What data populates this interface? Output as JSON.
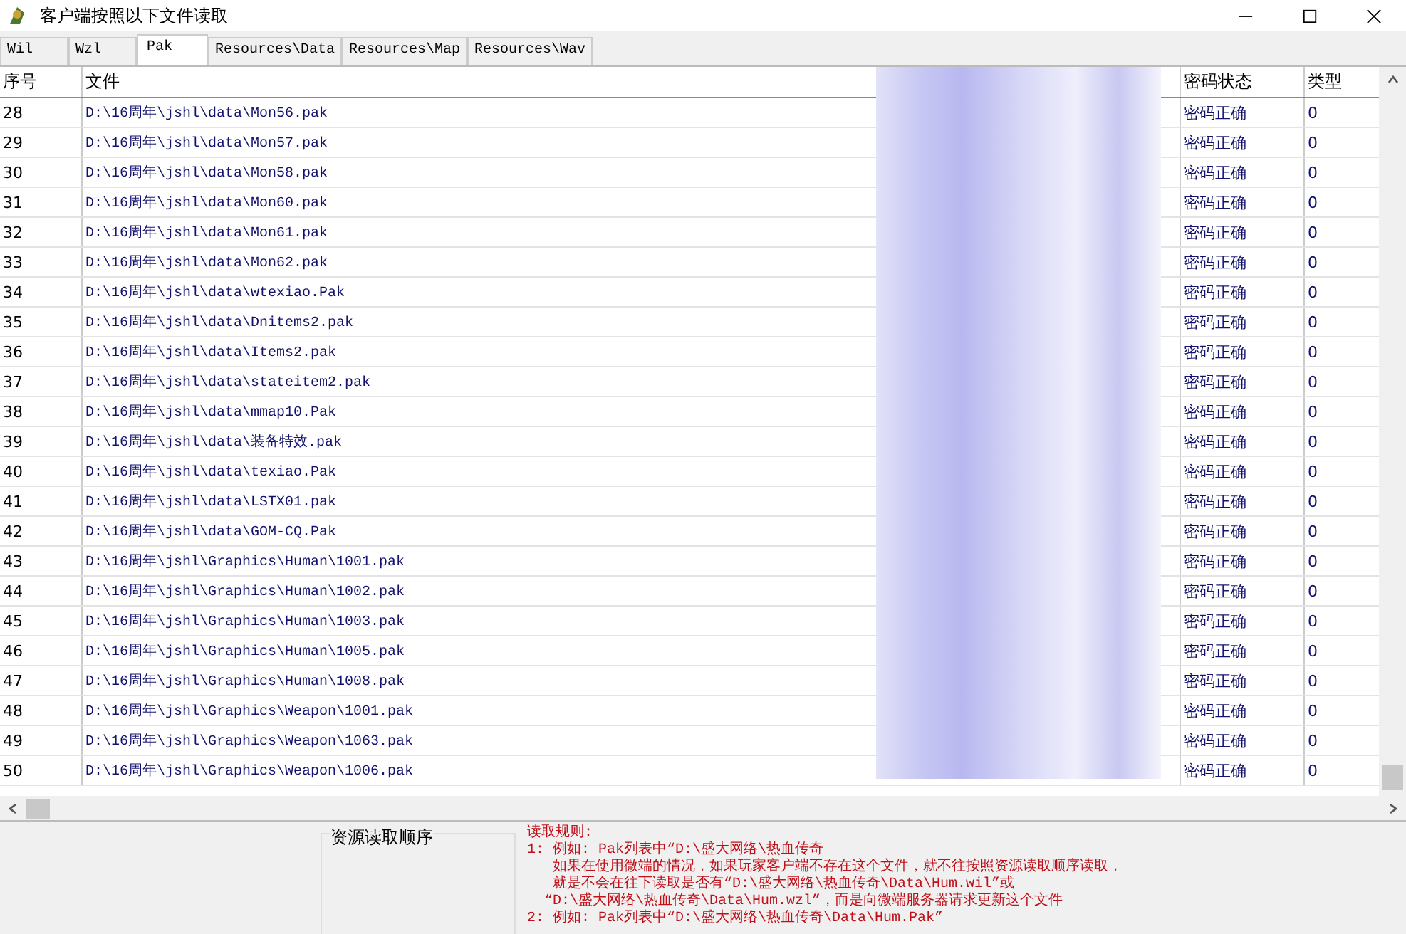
{
  "window": {
    "title": "客户端按照以下文件读取"
  },
  "tabs": [
    {
      "label": "Wil",
      "selected": false
    },
    {
      "label": "Wzl",
      "selected": false
    },
    {
      "label": "Pak",
      "selected": true
    },
    {
      "label": "Resources\\Data",
      "selected": false
    },
    {
      "label": "Resources\\Map",
      "selected": false
    },
    {
      "label": "Resources\\Wav",
      "selected": false
    }
  ],
  "table": {
    "columns": [
      "序号",
      "文件",
      "密码状态",
      "类型"
    ],
    "rows": [
      {
        "index": "28",
        "file": "D:\\16周年\\jshl\\data\\Mon56.pak",
        "status": "密码正确",
        "type": "0"
      },
      {
        "index": "29",
        "file": "D:\\16周年\\jshl\\data\\Mon57.pak",
        "status": "密码正确",
        "type": "0"
      },
      {
        "index": "30",
        "file": "D:\\16周年\\jshl\\data\\Mon58.pak",
        "status": "密码正确",
        "type": "0"
      },
      {
        "index": "31",
        "file": "D:\\16周年\\jshl\\data\\Mon60.pak",
        "status": "密码正确",
        "type": "0"
      },
      {
        "index": "32",
        "file": "D:\\16周年\\jshl\\data\\Mon61.pak",
        "status": "密码正确",
        "type": "0"
      },
      {
        "index": "33",
        "file": "D:\\16周年\\jshl\\data\\Mon62.pak",
        "status": "密码正确",
        "type": "0"
      },
      {
        "index": "34",
        "file": "D:\\16周年\\jshl\\data\\wtexiao.Pak",
        "status": "密码正确",
        "type": "0"
      },
      {
        "index": "35",
        "file": "D:\\16周年\\jshl\\data\\Dnitems2.pak",
        "status": "密码正确",
        "type": "0"
      },
      {
        "index": "36",
        "file": "D:\\16周年\\jshl\\data\\Items2.pak",
        "status": "密码正确",
        "type": "0"
      },
      {
        "index": "37",
        "file": "D:\\16周年\\jshl\\data\\stateitem2.pak",
        "status": "密码正确",
        "type": "0"
      },
      {
        "index": "38",
        "file": "D:\\16周年\\jshl\\data\\mmap10.Pak",
        "status": "密码正确",
        "type": "0"
      },
      {
        "index": "39",
        "file": "D:\\16周年\\jshl\\data\\装备特效.pak",
        "status": "密码正确",
        "type": "0"
      },
      {
        "index": "40",
        "file": "D:\\16周年\\jshl\\data\\texiao.Pak",
        "status": "密码正确",
        "type": "0"
      },
      {
        "index": "41",
        "file": "D:\\16周年\\jshl\\data\\LSTX01.pak",
        "status": "密码正确",
        "type": "0"
      },
      {
        "index": "42",
        "file": "D:\\16周年\\jshl\\data\\GOM-CQ.Pak",
        "status": "密码正确",
        "type": "0"
      },
      {
        "index": "43",
        "file": "D:\\16周年\\jshl\\Graphics\\Human\\1001.pak",
        "status": "密码正确",
        "type": "0"
      },
      {
        "index": "44",
        "file": "D:\\16周年\\jshl\\Graphics\\Human\\1002.pak",
        "status": "密码正确",
        "type": "0"
      },
      {
        "index": "45",
        "file": "D:\\16周年\\jshl\\Graphics\\Human\\1003.pak",
        "status": "密码正确",
        "type": "0"
      },
      {
        "index": "46",
        "file": "D:\\16周年\\jshl\\Graphics\\Human\\1005.pak",
        "status": "密码正确",
        "type": "0"
      },
      {
        "index": "47",
        "file": "D:\\16周年\\jshl\\Graphics\\Human\\1008.pak",
        "status": "密码正确",
        "type": "0"
      },
      {
        "index": "48",
        "file": "D:\\16周年\\jshl\\Graphics\\Weapon\\1001.pak",
        "status": "密码正确",
        "type": "0"
      },
      {
        "index": "49",
        "file": "D:\\16周年\\jshl\\Graphics\\Weapon\\1063.pak",
        "status": "密码正确",
        "type": "0"
      },
      {
        "index": "50",
        "file": "D:\\16周年\\jshl\\Graphics\\Weapon\\1006.pak",
        "status": "密码正确",
        "type": "0"
      }
    ]
  },
  "order_group": {
    "title": "资源读取顺序"
  },
  "rules": [
    "读取规则:",
    "1: 例如: Pak列表中“D:\\盛大网络\\热血传奇",
    "   如果在使用微端的情况，如果玩家客户端不存在这个文件，就不往按照资源读取顺序读取，",
    "   就是不会在往下读取是否有“D:\\盛大网络\\热血传奇\\Data\\Hum.wil”或",
    "  “D:\\盛大网络\\热血传奇\\Data\\Hum.wzl”，而是向微端服务器请求更新这个文件",
    "2: 例如: Pak列表中“D:\\盛大网络\\热血传奇\\Data\\Hum.Pak”"
  ]
}
